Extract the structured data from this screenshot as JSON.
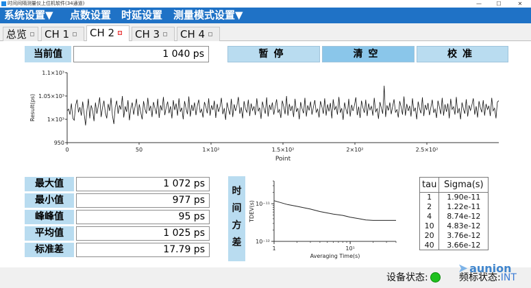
{
  "window": {
    "title": "时间间隔测量仪上位机软件(34通道)",
    "controls": [
      "—",
      "☐",
      "✕"
    ]
  },
  "menu": {
    "system": "系统设置▼",
    "points": "点数设置",
    "delay": "时延设置",
    "mode": "测量模式设置▼"
  },
  "tabs": [
    "总览",
    "CH 1",
    "CH 2",
    "CH 3",
    "CH 4"
  ],
  "current": {
    "label": "当前值",
    "value": "1 040 ps"
  },
  "buttons": {
    "pause": "暂停",
    "clear": "清空",
    "calibrate": "校准"
  },
  "colors": {
    "menu_bar": "#1f72c6",
    "label_bg": "#b9dcf0",
    "status_ok": "#1ec01e"
  },
  "chart_data": [
    {
      "type": "line",
      "title": "",
      "xlabel": "Point",
      "ylabel": "Result(ps)",
      "xlim": [
        0,
        300
      ],
      "ylim": [
        950,
        1100
      ],
      "x_ticks": [
        0,
        50,
        100,
        150,
        200,
        250
      ],
      "x_tick_labels": [
        "0",
        "50",
        "1×10²",
        "1.5×10²",
        "2×10²",
        "2.5×10²"
      ],
      "y_ticks": [
        950,
        1000,
        1050,
        1100
      ],
      "y_tick_labels": [
        "950",
        "1×10³",
        "1.05×10³",
        "1.1×10³"
      ],
      "grid": false,
      "series": [
        {
          "values": [
            1018,
            1022,
            1010,
            1034,
            1002,
            998,
            1030,
            1042,
            1015,
            1026,
            1008,
            1038,
            1012,
            987,
            1020,
            1044,
            1002,
            1030,
            1019,
            996,
            1036,
            1012,
            1028,
            1047,
            1005,
            1025,
            1040,
            1014,
            1002,
            1033,
            1018,
            1046,
            1008,
            990,
            1026,
            1040,
            1012,
            1030,
            1021,
            1050,
            1004,
            1028,
            1016,
            1041,
            998,
            1024,
            1036,
            1010,
            1027,
            1044,
            1007,
            1032,
            1015,
            1000,
            1039,
            1022,
            1012,
            1046,
            1018,
            1029,
            1005,
            1037,
            1024,
            1011,
            1044,
            1003,
            1030,
            1019,
            1048,
            1009,
            1026,
            1038,
            1013,
            1028,
            1002,
            1041,
            1020,
            1034,
            1008,
            1045,
            1016,
            1025,
            1000,
            1039,
            1023,
            1011,
            1049,
            1006,
            1031,
            1018,
            1036,
            1009,
            1029,
            1042,
            1014,
            1022,
            1004,
            1037,
            1027,
            1013,
            1045,
            1008,
            1030,
            1020,
            1040,
            1003,
            1033,
            1016,
            1027,
            1046,
            1011,
            1024,
            999,
            1036,
            1021,
            1010,
            1044,
            1005,
            1032,
            1018,
            1030,
            1048,
            1012,
            1026,
            1002,
            1039,
            1022,
            1015,
            1042,
            1007,
            1034,
            1019,
            1028,
            1009,
            1045,
            1017,
            1025,
            1001,
            1038,
            1024,
            1012,
            1047,
            1006,
            1031,
            1020,
            1036,
            1010,
            1027,
            1043,
            1014,
            1021,
            1003,
            1040,
            1028,
            1011,
            1050,
            1008,
            1033,
            1018,
            1029,
            1005,
            1044,
            1016,
            1024,
            1000,
            1037,
            1023,
            1013,
            1046,
            1006,
            1030,
            1019,
            1038,
            1010,
            1026,
            1041,
            1015,
            1022,
            1004,
            1039,
            1027,
            1012,
            1045,
            1008,
            1032,
            1017,
            1035,
            1002,
            1043,
            1020,
            1028,
            1010,
            1048,
            1014,
            1024,
            999,
            1036,
            1022,
            1011,
            1044,
            1006,
            1031,
            1018,
            1030,
            1047,
            1009,
            1027,
            1003,
            1040,
            1025,
            1014,
            1042,
            1007,
            1034,
            1020,
            1028,
            1008,
            1046,
            1016,
            1023,
            1001,
            1037,
            1024,
            1012,
            1072,
            1005,
            1030,
            1019,
            1036,
            1011,
            1028,
            1043,
            1015,
            1021,
            1004,
            1039,
            1026,
            1010,
            1049,
            1008,
            1033,
            1018,
            1029,
            1006,
            1045,
            1017,
            1025,
            1000,
            1038,
            1023,
            1013,
            1047,
            1007,
            1031,
            1020,
            1035,
            1009,
            1026,
            1042,
            1014,
            1022,
            1003,
            1040,
            1027,
            1011,
            1046,
            1008,
            1032,
            1016,
            1034,
            1002,
            1044,
            1021,
            1027,
            1010,
            1048,
            1013,
            1024,
            1000,
            1036,
            1022,
            1012,
            1043,
            1006,
            1030,
            1019,
            1031,
            1045,
            1010,
            1028,
            1004,
            1039,
            1025,
            1015,
            1041,
            1008,
            1033,
            1021,
            1029,
            1007,
            1046,
            1018,
            1024,
            1002,
            1037,
            1040
          ]
        }
      ]
    },
    {
      "type": "line",
      "title": "",
      "xlabel": "Averaging Time(s)",
      "ylabel": "TDEV(s)",
      "x_scale": "log",
      "y_scale": "log",
      "xlim": [
        1,
        40
      ],
      "ylim": [
        1e-12,
        4e-11
      ],
      "x_tick_labels": [
        "1",
        "10¹"
      ],
      "y_tick_labels": [
        "10⁻¹²",
        "10⁻¹¹"
      ],
      "grid": false,
      "series": [
        {
          "x": [
            1,
            1.5,
            2,
            3,
            4,
            6,
            8,
            10,
            13,
            16,
            20,
            25,
            30,
            35,
            40
          ],
          "values": [
            1.2e-11,
            9.5e-12,
            8.5e-12,
            7.2e-12,
            6.2e-12,
            5.3e-12,
            4.9e-12,
            4.4e-12,
            4e-12,
            3.7e-12,
            3.6e-12,
            3.6e-12,
            3.6e-12,
            3.6e-12,
            3.6e-12
          ]
        }
      ]
    }
  ],
  "stats": [
    {
      "label": "最大值",
      "value": "1 072 ps"
    },
    {
      "label": "最小值",
      "value": "977 ps"
    },
    {
      "label": "峰峰值",
      "value": "95 ps"
    },
    {
      "label": "平均值",
      "value": "1 025 ps"
    },
    {
      "label": "标准差",
      "value": "17.79 ps"
    }
  ],
  "variance_label": [
    "时",
    "间",
    "方",
    "差"
  ],
  "sigma_table": {
    "headers": [
      "tau",
      "Sigma(s)"
    ],
    "rows": [
      [
        "1",
        "1.90e-11"
      ],
      [
        "2",
        "1.22e-11"
      ],
      [
        "4",
        "8.74e-12"
      ],
      [
        "10",
        "4.83e-12"
      ],
      [
        "20",
        "3.76e-12"
      ],
      [
        "40",
        "3.66e-12"
      ]
    ]
  },
  "status": {
    "device_label": "设备状态:",
    "freq_label": "频标状态:",
    "freq_value": "INT"
  },
  "logo": {
    "text": "aunion"
  }
}
